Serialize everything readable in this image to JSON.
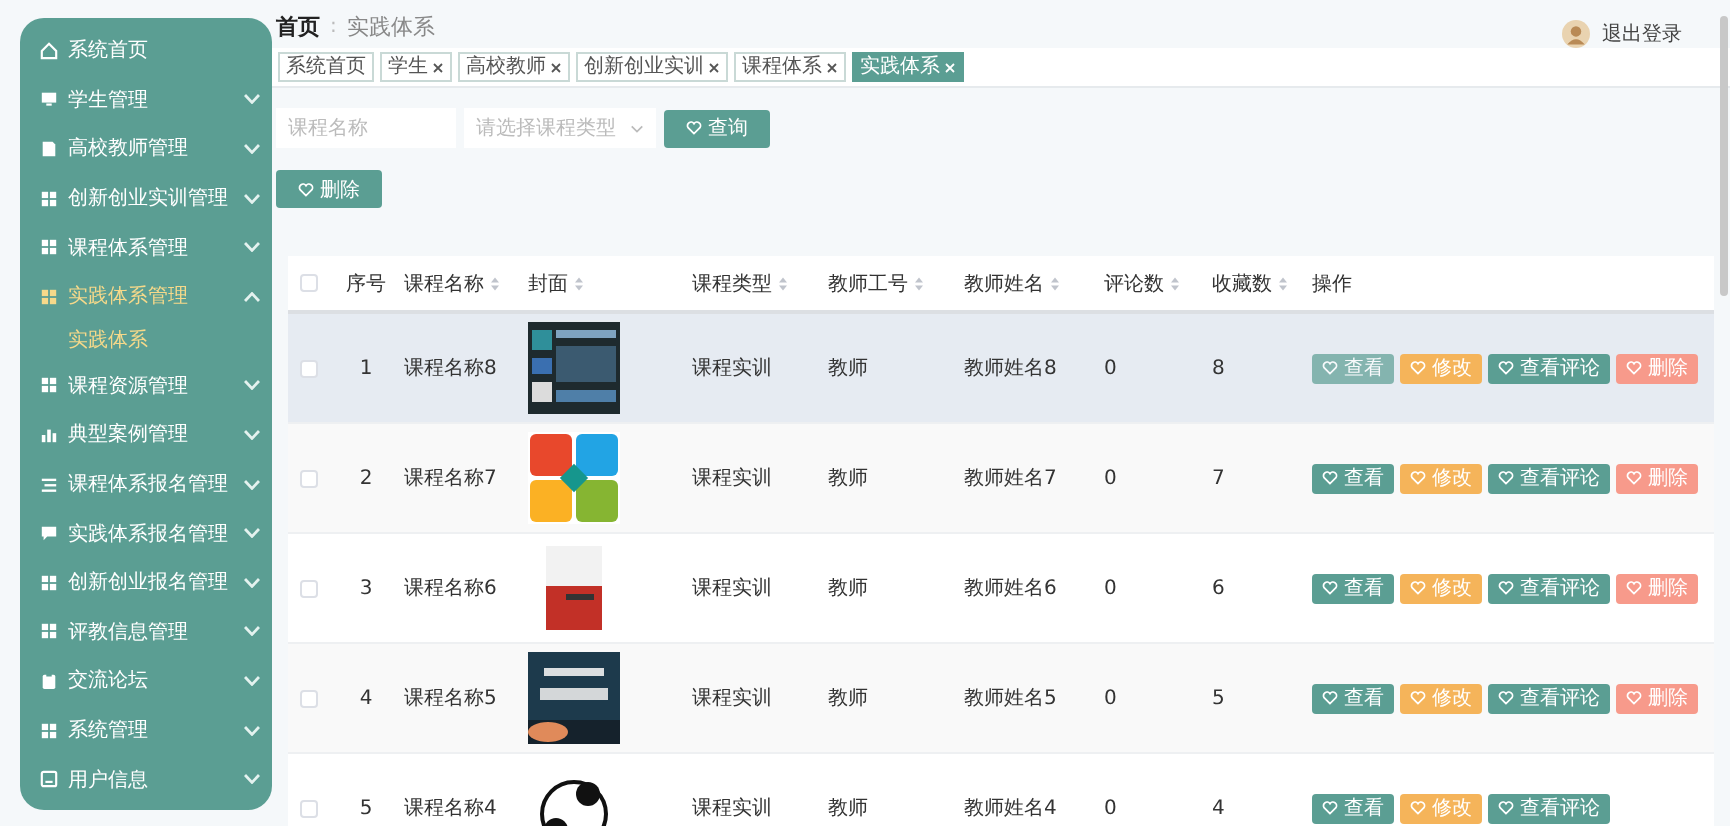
{
  "sidebar": {
    "items": [
      {
        "label": "系统首页",
        "has_children": false,
        "active": false
      },
      {
        "label": "学生管理",
        "expanded": false,
        "has_children": true,
        "active": false
      },
      {
        "label": "高校教师管理",
        "expanded": false,
        "has_children": true,
        "active": false
      },
      {
        "label": "创新创业实训管理",
        "expanded": false,
        "has_children": true,
        "active": false
      },
      {
        "label": "课程体系管理",
        "expanded": false,
        "has_children": true,
        "active": false
      },
      {
        "label": "实践体系管理",
        "expanded": true,
        "has_children": true,
        "active": true,
        "children": [
          {
            "label": "实践体系",
            "active": true
          }
        ]
      },
      {
        "label": "课程资源管理",
        "expanded": false,
        "has_children": true,
        "active": false
      },
      {
        "label": "典型案例管理",
        "expanded": false,
        "has_children": true,
        "active": false
      },
      {
        "label": "课程体系报名管理",
        "expanded": false,
        "has_children": true,
        "active": false
      },
      {
        "label": "实践体系报名管理",
        "expanded": false,
        "has_children": true,
        "active": false
      },
      {
        "label": "创新创业报名管理",
        "expanded": false,
        "has_children": true,
        "active": false
      },
      {
        "label": "评教信息管理",
        "expanded": false,
        "has_children": true,
        "active": false
      },
      {
        "label": "交流论坛",
        "expanded": false,
        "has_children": true,
        "active": false
      },
      {
        "label": "系统管理",
        "expanded": false,
        "has_children": true,
        "active": false
      },
      {
        "label": "用户信息",
        "expanded": false,
        "has_children": true,
        "active": false
      }
    ]
  },
  "header": {
    "logout": "退出登录"
  },
  "breadcrumb": {
    "items": [
      "首页",
      "实践体系"
    ],
    "separator": ":"
  },
  "tags": [
    {
      "label": "系统首页",
      "selected": false,
      "closable": false
    },
    {
      "label": "学生",
      "selected": false,
      "closable": true
    },
    {
      "label": "高校教师",
      "selected": false,
      "closable": true
    },
    {
      "label": "创新创业实训",
      "selected": false,
      "closable": true
    },
    {
      "label": "课程体系",
      "selected": false,
      "closable": true
    },
    {
      "label": "实践体系",
      "selected": true,
      "closable": true
    }
  ],
  "search": {
    "name_placeholder": "课程名称",
    "type_placeholder": "请选择课程类型",
    "button": "查询"
  },
  "delete_button": "删除",
  "table": {
    "header_checked": false,
    "columns": [
      {
        "label": "序号",
        "sortable": false
      },
      {
        "label": "课程名称",
        "sortable": true
      },
      {
        "label": "封面",
        "sortable": true
      },
      {
        "label": "课程类型",
        "sortable": true
      },
      {
        "label": "教师工号",
        "sortable": true
      },
      {
        "label": "教师姓名",
        "sortable": true
      },
      {
        "label": "评论数",
        "sortable": true
      },
      {
        "label": "收藏数",
        "sortable": true
      },
      {
        "label": "操作",
        "sortable": false
      }
    ],
    "rows": [
      {
        "checked": false,
        "hovered": true,
        "cells": [
          "1",
          "课程名称8",
          {
            "kind": "picture"
          },
          "课程实训",
          "教师",
          "教师姓名8",
          "0",
          "8"
        ],
        "actions": [
          {
            "kind": "view",
            "label": "查看",
            "hovered": true
          },
          {
            "kind": "edit",
            "label": "修改",
            "hovered": false
          },
          {
            "kind": "view",
            "label": "查看评论",
            "hovered": false
          },
          {
            "kind": "delete",
            "label": "删除",
            "hovered": false
          }
        ]
      },
      {
        "checked": false,
        "hovered": false,
        "cells": [
          "2",
          "课程名称7",
          {
            "kind": "picture"
          },
          "课程实训",
          "教师",
          "教师姓名7",
          "0",
          "7"
        ],
        "actions": [
          {
            "kind": "view",
            "label": "查看",
            "hovered": false
          },
          {
            "kind": "edit",
            "label": "修改",
            "hovered": false
          },
          {
            "kind": "view",
            "label": "查看评论",
            "hovered": false
          },
          {
            "kind": "delete",
            "label": "删除",
            "hovered": false
          }
        ]
      },
      {
        "checked": false,
        "hovered": false,
        "cells": [
          "3",
          "课程名称6",
          {
            "kind": "picture"
          },
          "课程实训",
          "教师",
          "教师姓名6",
          "0",
          "6"
        ],
        "actions": [
          {
            "kind": "view",
            "label": "查看",
            "hovered": false
          },
          {
            "kind": "edit",
            "label": "修改",
            "hovered": false
          },
          {
            "kind": "view",
            "label": "查看评论",
            "hovered": false
          },
          {
            "kind": "delete",
            "label": "删除",
            "hovered": false
          }
        ]
      },
      {
        "checked": false,
        "hovered": false,
        "cells": [
          "4",
          "课程名称5",
          {
            "kind": "picture"
          },
          "课程实训",
          "教师",
          "教师姓名5",
          "0",
          "5"
        ],
        "actions": [
          {
            "kind": "view",
            "label": "查看",
            "hovered": false
          },
          {
            "kind": "edit",
            "label": "修改",
            "hovered": false
          },
          {
            "kind": "view",
            "label": "查看评论",
            "hovered": false
          },
          {
            "kind": "delete",
            "label": "删除",
            "hovered": false
          }
        ]
      },
      {
        "checked": false,
        "hovered": false,
        "cells": [
          "5",
          "课程名称4",
          {
            "kind": "picture"
          },
          "课程实训",
          "教师",
          "教师姓名4",
          "0",
          "4"
        ],
        "actions": [
          {
            "kind": "view",
            "label": "查看",
            "hovered": false
          },
          {
            "kind": "edit",
            "label": "修改",
            "hovered": false
          },
          {
            "kind": "view",
            "label": "查看评论",
            "hovered": false
          }
        ]
      }
    ]
  }
}
